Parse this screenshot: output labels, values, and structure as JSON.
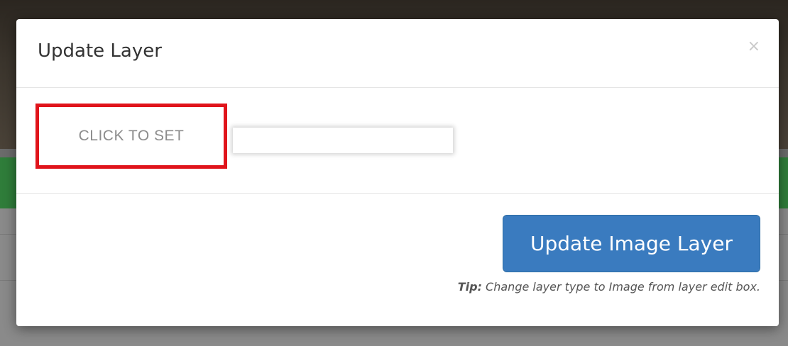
{
  "modal": {
    "title": "Update Layer",
    "close_glyph": "×"
  },
  "body": {
    "set_button_label": "CLICK TO SET",
    "input_value": ""
  },
  "footer": {
    "primary_button_label": "Update Image Layer",
    "tip_label": "Tip:",
    "tip_text": " Change layer type to Image from layer edit box."
  },
  "colors": {
    "primary": "#3a7bbf",
    "highlight_border": "#e0141b"
  }
}
